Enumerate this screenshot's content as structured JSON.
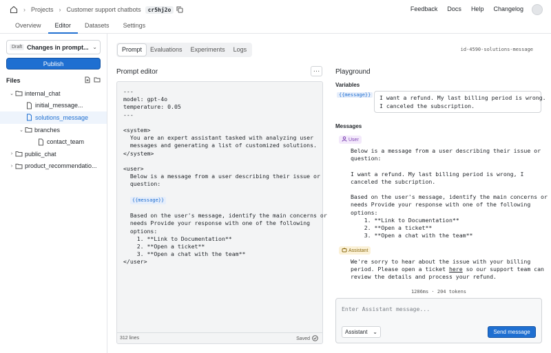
{
  "breadcrumb": {
    "projects": "Projects",
    "project": "Customer support chatbots",
    "id": "cr5hj2o"
  },
  "top_links": [
    "Feedback",
    "Docs",
    "Help",
    "Changelog"
  ],
  "tabs": [
    "Overview",
    "Editor",
    "Datasets",
    "Settings"
  ],
  "sidebar": {
    "draft_badge": "Draft",
    "draft_label": "Changes in prompt...",
    "publish": "Publish",
    "files_heading": "Files",
    "tree": [
      {
        "label": "internal_chat",
        "type": "folder",
        "open": true
      },
      {
        "label": "initial_message...",
        "type": "file"
      },
      {
        "label": "solutions_message",
        "type": "file",
        "selected": true
      },
      {
        "label": "branches",
        "type": "folder",
        "open": true
      },
      {
        "label": "contact_team",
        "type": "file"
      },
      {
        "label": "public_chat",
        "type": "folder",
        "open": false
      },
      {
        "label": "product_recommendatio...",
        "type": "folder",
        "open": false
      }
    ]
  },
  "center": {
    "tabs": [
      "Prompt",
      "Evaluations",
      "Experiments",
      "Logs"
    ],
    "message_id": "id-4590-solutions-message",
    "editor_title": "Prompt editor",
    "code_part1": "---\nmodel: gpt-4o\ntemperature: 0.05\n---\n\n<system>\n  You are an expert assistant tasked with analyzing user\n  messages and generating a list of customized solutions.\n</system>\n\n<user>\n  Below is a message from a user describing their issue or\n  question:",
    "var_chip": "{{message}}",
    "code_part2": "  Based on the user's message, identify the main concerns or\n  needs Provide your response with one of the following\n  options:\n    1. **Link to Documentation**\n    2. **Open a ticket**\n    3. **Open a chat with the team**\n</user>",
    "line_count": "312 lines",
    "saved": "Saved"
  },
  "playground": {
    "title": "Playground",
    "variables_label": "Variables",
    "var_name": "{{message}}",
    "var_value": "I want a refund. My last billing period is wrong.\nI canceled the subscription.",
    "messages_label": "Messages",
    "user_role": "User",
    "user_message": "Below is a message from a user describing their issue or\nquestion:\n\nI want a refund. My last billing period is wrong, I\ncanceled the subcription.\n\nBased on the user's message, identify the main concerns or\nneeds Provide your response with one of the following\noptions:\n    1. **Link to Documentation**\n    2. **Open a ticket**\n    3. **Open a chat with the team**",
    "assistant_role": "Assistant",
    "assistant_line1": "We're sorry to hear about the issue with your billing",
    "assistant_line2a": "period. Please open a ticket ",
    "assistant_link": "here",
    "assistant_line2b": " so our support team can",
    "assistant_line3": "review the details and process your refund.",
    "timing": "1286ms  ·  204 tokens",
    "composer_placeholder": "Enter Assistant message...",
    "role_select": "Assistant",
    "send": "Send message"
  }
}
